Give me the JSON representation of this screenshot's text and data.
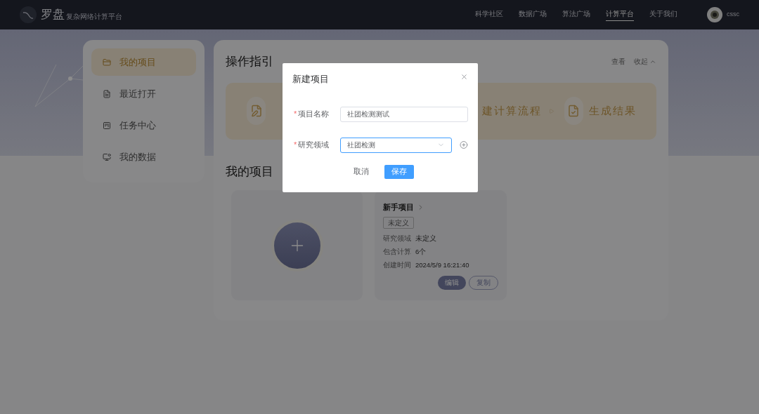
{
  "header": {
    "logo": "罗盘",
    "subtitle": "复杂网络计算平台",
    "nav": [
      {
        "label": "科学社区",
        "selected": false
      },
      {
        "label": "数据广场",
        "selected": false
      },
      {
        "label": "算法广场",
        "selected": false
      },
      {
        "label": "计算平台",
        "selected": true
      },
      {
        "label": "关于我们",
        "selected": false
      }
    ],
    "user": "cssc"
  },
  "sidebar": {
    "items": [
      {
        "label": "我的项目",
        "selected": true
      },
      {
        "label": "最近打开",
        "selected": false
      },
      {
        "label": "任务中心",
        "selected": false
      },
      {
        "label": "我的数据",
        "selected": false
      }
    ]
  },
  "guide": {
    "title": "操作指引",
    "actions": [
      "查看",
      "收起"
    ],
    "steps": [
      "建计算流程",
      "生成结果"
    ]
  },
  "projects": {
    "title": "我的项目",
    "cards": [
      {
        "name": "新手项目",
        "tag": "未定义",
        "fields": [
          {
            "label": "研究领域",
            "value": "未定义"
          },
          {
            "label": "包含计算",
            "value": "6个"
          },
          {
            "label": "创建时间",
            "value": "2024/5/9 16:21:40"
          }
        ],
        "buttons": [
          {
            "label": "编辑",
            "kind": "primary"
          },
          {
            "label": "复制",
            "kind": "outline"
          }
        ]
      }
    ]
  },
  "dialog": {
    "title": "新建项目",
    "fields": [
      {
        "label": "项目名称",
        "required_mark": "*",
        "kind": "input",
        "value": "社团检测测试",
        "focused": false
      },
      {
        "label": "研究领域",
        "required_mark": "*",
        "kind": "select",
        "value": "社团检测",
        "focused": true
      }
    ],
    "buttons": [
      {
        "label": "取消",
        "kind": "default"
      },
      {
        "label": "保存",
        "kind": "primary"
      }
    ]
  }
}
